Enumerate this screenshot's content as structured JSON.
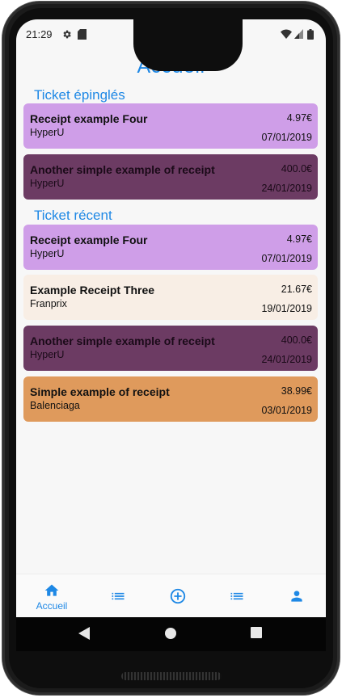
{
  "status_bar": {
    "time": "21:29"
  },
  "page": {
    "title": "Accueil"
  },
  "pinned": {
    "heading": "Ticket épinglés",
    "tickets": [
      {
        "name": "Receipt example Four",
        "shop": "HyperU",
        "amount": "4.97€",
        "date": "07/01/2019",
        "color": "#cf9ee8",
        "text_color": "#111111"
      },
      {
        "name": "Another simple example of receipt",
        "shop": "HyperU",
        "amount": "400.0€",
        "date": "24/01/2019",
        "color": "#6c3b63",
        "text_color": "#1a0a18"
      }
    ]
  },
  "recent": {
    "heading": "Ticket récent",
    "tickets": [
      {
        "name": "Receipt example Four",
        "shop": "HyperU",
        "amount": "4.97€",
        "date": "07/01/2019",
        "color": "#cf9ee8",
        "text_color": "#111111"
      },
      {
        "name": "Example Receipt Three",
        "shop": "Franprix",
        "amount": "21.67€",
        "date": "19/01/2019",
        "color": "#f8eee5",
        "text_color": "#111111"
      },
      {
        "name": "Another simple example of receipt",
        "shop": "HyperU",
        "amount": "400.0€",
        "date": "24/01/2019",
        "color": "#6c3b63",
        "text_color": "#1a0a18"
      },
      {
        "name": "Simple example of receipt",
        "shop": "Balenciaga",
        "amount": "38.99€",
        "date": "03/01/2019",
        "color": "#df9a5c",
        "text_color": "#111111"
      }
    ]
  },
  "bottom_nav": {
    "items": [
      {
        "icon": "home-icon",
        "label": "Accueil",
        "active": true
      },
      {
        "icon": "list-icon",
        "label": ""
      },
      {
        "icon": "add-circle-icon",
        "label": ""
      },
      {
        "icon": "list-icon",
        "label": ""
      },
      {
        "icon": "person-icon",
        "label": ""
      }
    ]
  },
  "colors": {
    "accent": "#1e88e5",
    "background": "#f7f7f7"
  }
}
